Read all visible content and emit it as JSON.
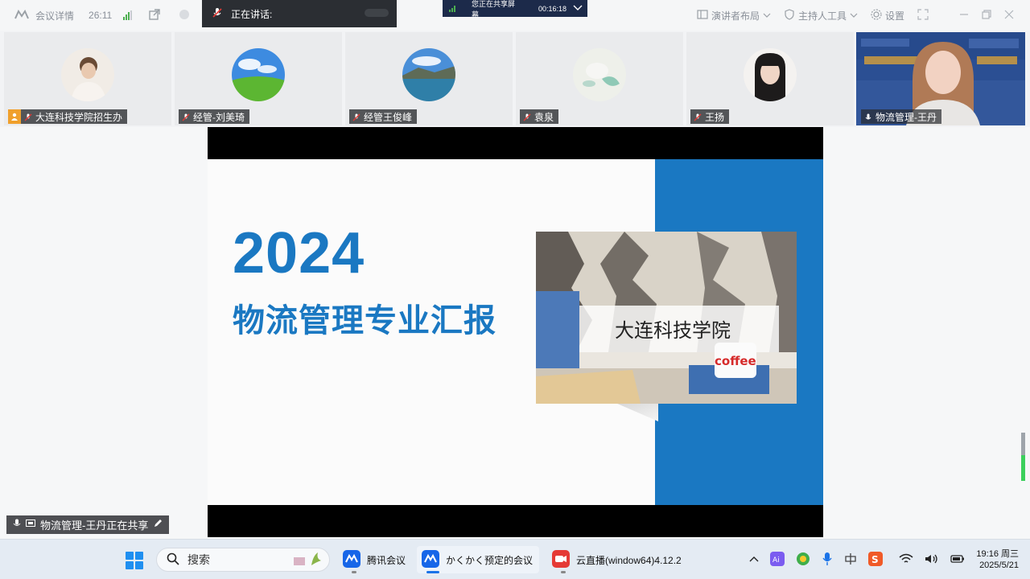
{
  "topbar": {
    "meeting_details": "会议详情",
    "timer": "26:11",
    "speaking_label": "正在讲话:",
    "sharing_notice": "您正在共享屏幕",
    "sharing_time": "00:16:18",
    "presenter_layout": "演讲者布局",
    "host_tools": "主持人工具",
    "settings": "设置"
  },
  "participants": [
    {
      "name": "大连科技学院招生办",
      "is_host": true
    },
    {
      "name": "经管-刘美琦",
      "is_host": false
    },
    {
      "name": "经管王俊峰",
      "is_host": false
    },
    {
      "name": "袁泉",
      "is_host": false
    },
    {
      "name": "王扬",
      "is_host": false
    },
    {
      "name": "物流管理-王丹",
      "is_host": false
    }
  ],
  "slide": {
    "year": "2024",
    "subtitle": "物流管理专业汇报",
    "photo_sign_text": "大连科技学院",
    "photo_pillow_text": "coffee"
  },
  "sharer_tag": "物流管理-王丹正在共享",
  "taskbar": {
    "search_placeholder": "搜索",
    "apps": [
      {
        "label": "腾讯会议"
      },
      {
        "label": "かくかく预定的会议"
      },
      {
        "label": "云直播(window64)4.12.2"
      }
    ],
    "time": "19:16 周三",
    "date": "2025/5/21"
  },
  "colors": {
    "accent_blue": "#1a78c2",
    "taskbar_bg": "#e4ebf3"
  }
}
